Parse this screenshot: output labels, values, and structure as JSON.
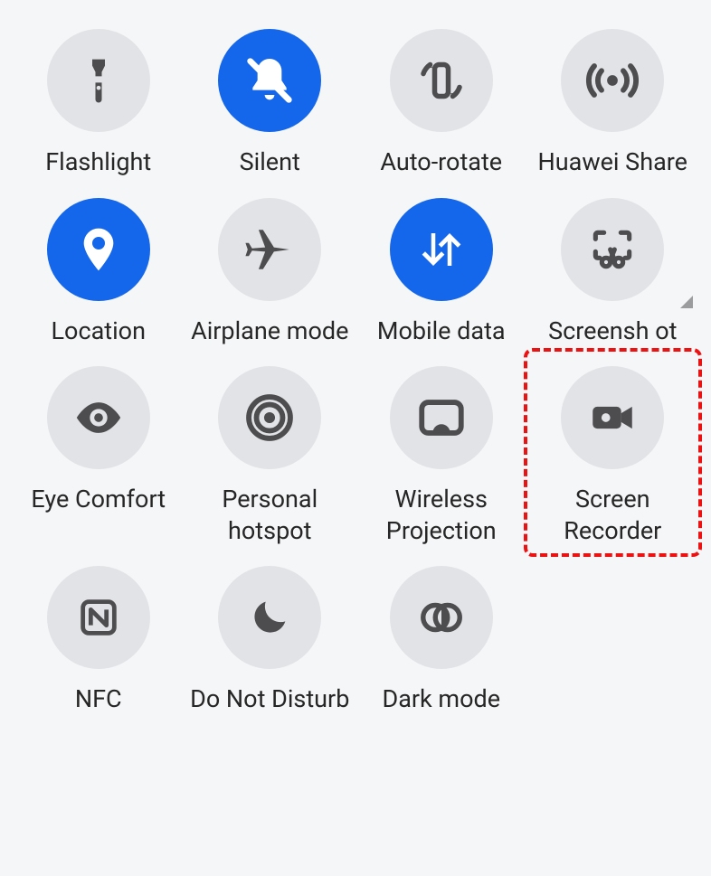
{
  "colors": {
    "active_bg": "#1467ea",
    "inactive_bg": "#e2e3e6",
    "icon_inactive": "#4d4d4f",
    "icon_active": "#ffffff",
    "highlight": "#ee1111"
  },
  "tiles": [
    {
      "id": "flashlight",
      "label": "Flashlight",
      "active": false,
      "highlighted": false,
      "expandable": false
    },
    {
      "id": "silent",
      "label": "Silent",
      "active": true,
      "highlighted": false,
      "expandable": false
    },
    {
      "id": "auto-rotate",
      "label": "Auto-rotate",
      "active": false,
      "highlighted": false,
      "expandable": false
    },
    {
      "id": "huawei-share",
      "label": "Huawei Share",
      "active": false,
      "highlighted": false,
      "expandable": false
    },
    {
      "id": "location",
      "label": "Location",
      "active": true,
      "highlighted": false,
      "expandable": false
    },
    {
      "id": "airplane-mode",
      "label": "Airplane mode",
      "active": false,
      "highlighted": false,
      "expandable": false
    },
    {
      "id": "mobile-data",
      "label": "Mobile data",
      "active": true,
      "highlighted": false,
      "expandable": false
    },
    {
      "id": "screenshot",
      "label": "Screensh ot",
      "active": false,
      "highlighted": false,
      "expandable": true
    },
    {
      "id": "eye-comfort",
      "label": "Eye Comfort",
      "active": false,
      "highlighted": false,
      "expandable": false
    },
    {
      "id": "personal-hotspot",
      "label": "Personal hotspot",
      "active": false,
      "highlighted": false,
      "expandable": false
    },
    {
      "id": "wireless-proj",
      "label": "Wireless Projection",
      "active": false,
      "highlighted": false,
      "expandable": false
    },
    {
      "id": "screen-recorder",
      "label": "Screen Recorder",
      "active": false,
      "highlighted": true,
      "expandable": false
    },
    {
      "id": "nfc",
      "label": "NFC",
      "active": false,
      "highlighted": false,
      "expandable": false
    },
    {
      "id": "do-not-disturb",
      "label": "Do Not Disturb",
      "active": false,
      "highlighted": false,
      "expandable": false
    },
    {
      "id": "dark-mode",
      "label": "Dark mode",
      "active": false,
      "highlighted": false,
      "expandable": false
    }
  ]
}
